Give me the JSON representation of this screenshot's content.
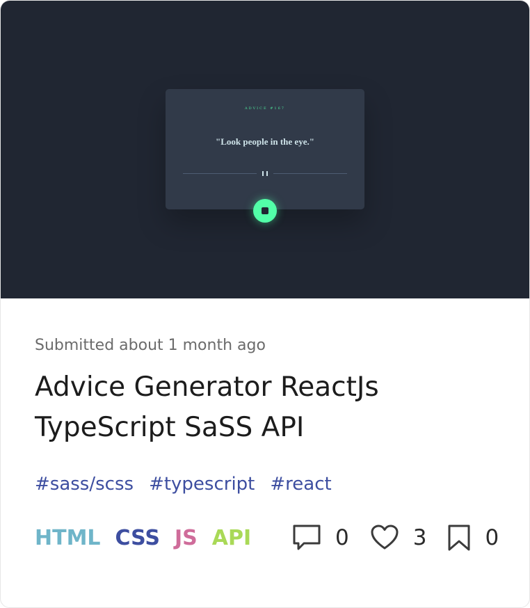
{
  "preview": {
    "advice_heading": "ADVICE #167",
    "advice_quote": "\"Look people in the eye.\""
  },
  "submission": {
    "meta": "Submitted about 1 month ago",
    "title": "Advice Generator ReactJs TypeScript SaSS API"
  },
  "hashtags": [
    "#sass/scss",
    "#typescript",
    "#react"
  ],
  "languages": [
    {
      "label": "HTML",
      "color": "#6fb5c9"
    },
    {
      "label": "CSS",
      "color": "#3d4ea0"
    },
    {
      "label": "JS",
      "color": "#cf6c9a"
    },
    {
      "label": "API",
      "color": "#a9d957"
    }
  ],
  "stats": {
    "comments": "0",
    "likes": "3",
    "bookmarks": "0"
  },
  "icons": [
    "comment-icon",
    "heart-icon",
    "bookmark-icon",
    "dice-icon",
    "pause-icon"
  ]
}
